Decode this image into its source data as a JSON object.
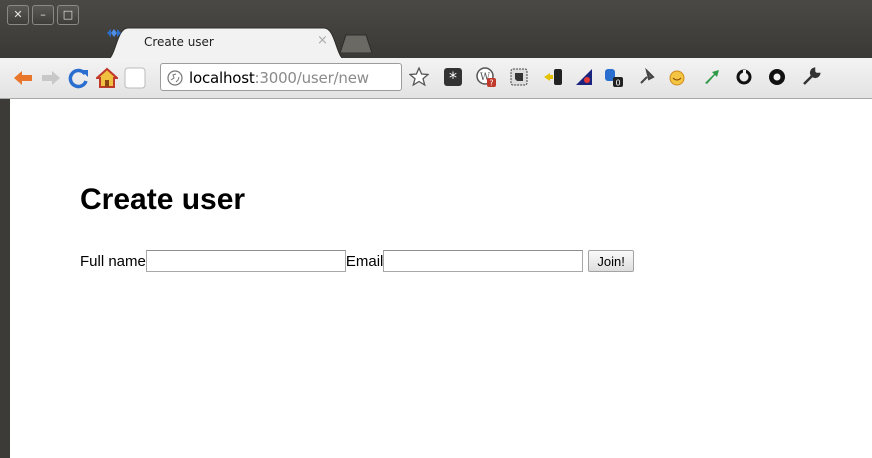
{
  "window": {
    "close_glyph": "✕",
    "minimize_glyph": "–",
    "maximize_glyph": "□"
  },
  "tab": {
    "title": "Create user",
    "close_glyph": "×"
  },
  "toolbar": {
    "url_host": "localhost",
    "url_path": ":3000/user/new",
    "extension_badges": {
      "wordpress": "?",
      "phone_notify": "0"
    }
  },
  "page": {
    "heading": "Create user",
    "form": {
      "fullname_label": "Full name",
      "fullname_value": "",
      "email_label": "Email",
      "email_value": "",
      "submit_label": "Join!"
    }
  },
  "colors": {
    "titlebar": "#3c3b37",
    "toolbar": "#ebebeb",
    "back_arrow": "#e8762b",
    "home": "#c0392b",
    "tab_icon": "#2a6ecf"
  }
}
